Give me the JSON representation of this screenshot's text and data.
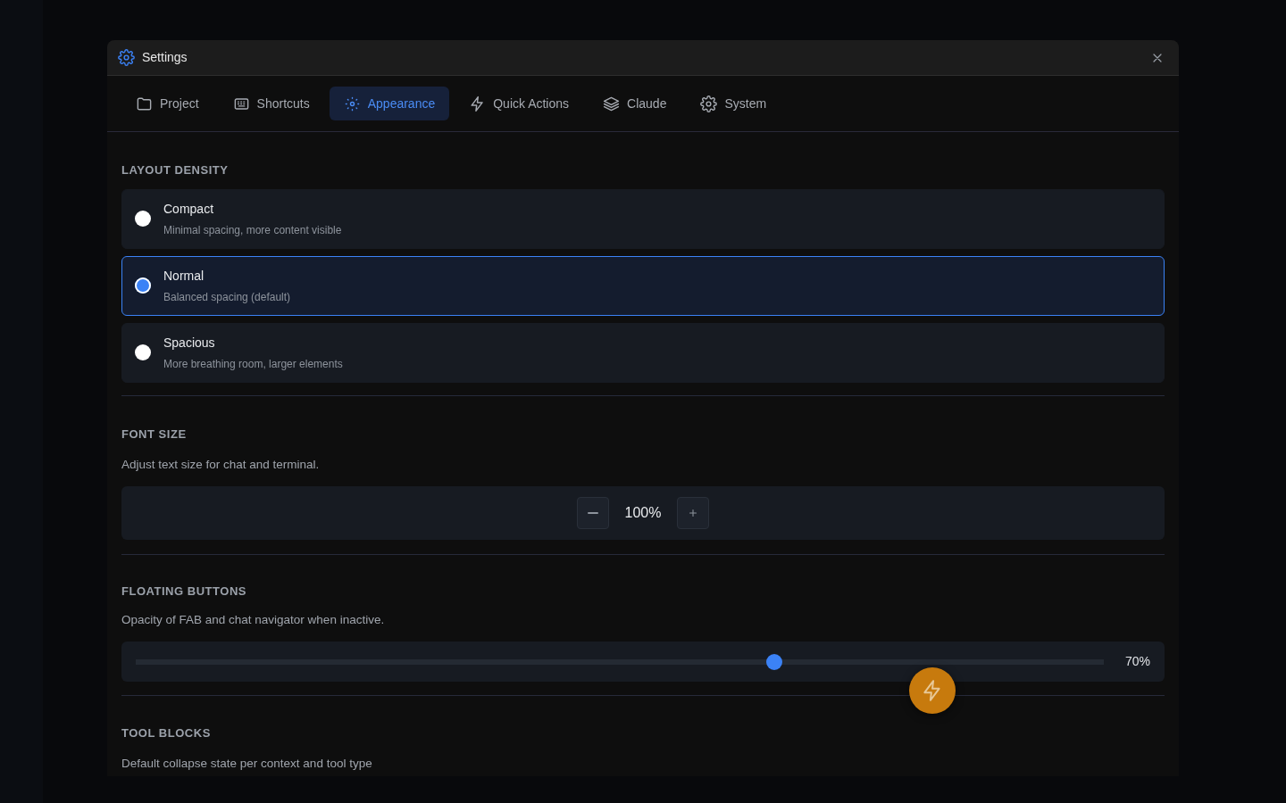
{
  "dialog": {
    "title": "Settings"
  },
  "tabs": [
    {
      "label": "Project",
      "selected": false
    },
    {
      "label": "Shortcuts",
      "selected": false
    },
    {
      "label": "Appearance",
      "selected": true
    },
    {
      "label": "Quick Actions",
      "selected": false
    },
    {
      "label": "Claude",
      "selected": false
    },
    {
      "label": "System",
      "selected": false
    }
  ],
  "layout_density": {
    "heading": "LAYOUT DENSITY",
    "options": [
      {
        "label": "Compact",
        "description": "Minimal spacing, more content visible",
        "selected": false
      },
      {
        "label": "Normal",
        "description": "Balanced spacing (default)",
        "selected": true
      },
      {
        "label": "Spacious",
        "description": "More breathing room, larger elements",
        "selected": false
      }
    ]
  },
  "font_size": {
    "heading": "FONT SIZE",
    "description": "Adjust text size for chat and terminal.",
    "value": "100%"
  },
  "floating_buttons": {
    "heading": "FLOATING BUTTONS",
    "description": "Opacity of FAB and chat navigator when inactive.",
    "level": 0.66,
    "reading": "70%"
  },
  "tool_blocks": {
    "heading": "TOOL BLOCKS",
    "description": "Default collapse state per context and tool type"
  }
}
